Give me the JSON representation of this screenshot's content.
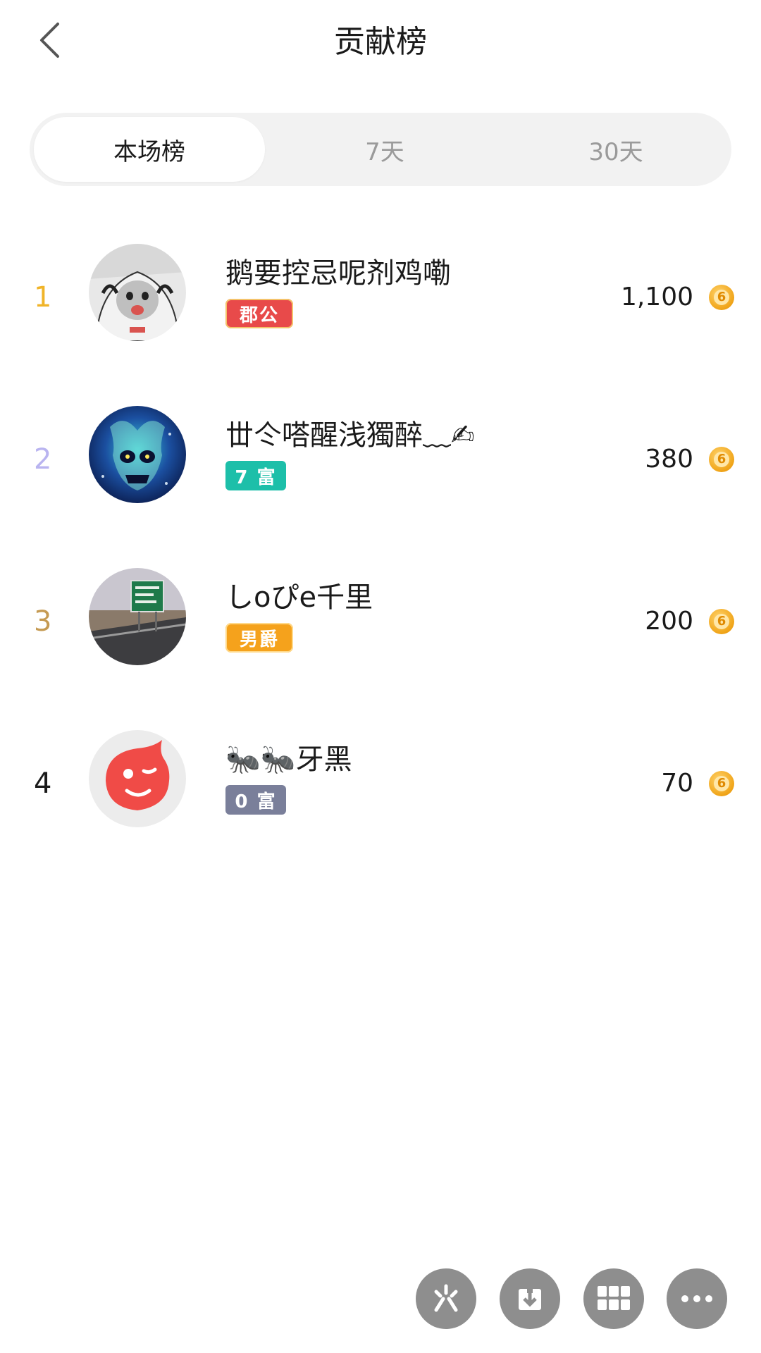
{
  "header": {
    "title": "贡献榜",
    "back_icon": "chevron-left-icon"
  },
  "tabs": [
    {
      "label": "本场榜",
      "active": true
    },
    {
      "label": "7天",
      "active": false
    },
    {
      "label": "30天",
      "active": false
    }
  ],
  "rows": [
    {
      "rank": "1",
      "rank_color": "#f0b429",
      "name": "鹅要控忌呢剂鸡嘞",
      "badge": "郡公",
      "badge_color": "#e84a4a",
      "score": "1,100",
      "avatar": "cat-hoodie-avatar"
    },
    {
      "rank": "2",
      "rank_color": "#b9b4f0",
      "name": "丗仒嗒醒浅獨醉﹏✍",
      "badge": "7 富",
      "badge_color": "#1dbfa9",
      "score": "380",
      "avatar": "blue-skull-avatar"
    },
    {
      "rank": "3",
      "rank_color": "#c59a52",
      "name": "しoぴe千里",
      "badge": "男爵",
      "badge_color": "#f5a21c",
      "score": "200",
      "avatar": "highway-sign-avatar"
    },
    {
      "rank": "4",
      "rank_color": "#1a1a1a",
      "name": "🐜🐜牙黑",
      "badge": "0 富",
      "badge_color": "#7a7f9a",
      "score": "70",
      "avatar": "red-wink-avatar"
    }
  ],
  "bottom_actions": [
    {
      "icon": "sparkle-icon"
    },
    {
      "icon": "download-icon"
    },
    {
      "icon": "grid-icon"
    },
    {
      "icon": "more-icon"
    }
  ]
}
